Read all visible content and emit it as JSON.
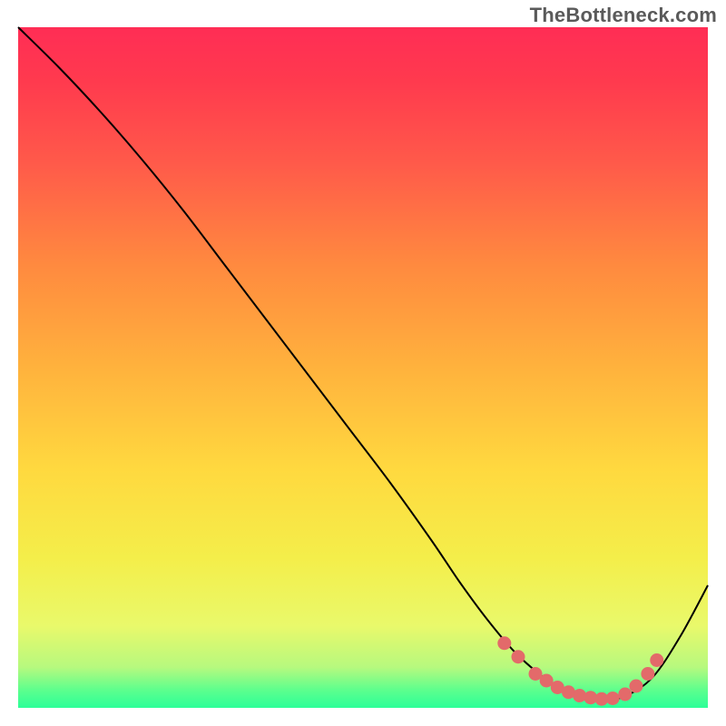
{
  "watermark": "TheBottleneck.com",
  "plot": {
    "margin_left": 20,
    "margin_right": 20,
    "margin_top": 30,
    "margin_bottom": 20,
    "gradient_stops": [
      {
        "offset": 0.0,
        "color": "#ff2d55"
      },
      {
        "offset": 0.08,
        "color": "#ff3a4e"
      },
      {
        "offset": 0.2,
        "color": "#ff5a4a"
      },
      {
        "offset": 0.35,
        "color": "#ff8a3f"
      },
      {
        "offset": 0.5,
        "color": "#ffb23d"
      },
      {
        "offset": 0.65,
        "color": "#ffd93f"
      },
      {
        "offset": 0.78,
        "color": "#f4ee4a"
      },
      {
        "offset": 0.88,
        "color": "#e9f96b"
      },
      {
        "offset": 0.94,
        "color": "#b7f97e"
      },
      {
        "offset": 0.975,
        "color": "#5aff8e"
      },
      {
        "offset": 1.0,
        "color": "#2cff98"
      }
    ]
  },
  "chart_data": {
    "type": "line",
    "title": "",
    "xlabel": "",
    "ylabel": "",
    "xlim": [
      0,
      100
    ],
    "ylim": [
      0,
      100
    ],
    "series": [
      {
        "name": "bottleneck-curve",
        "x": [
          0,
          6,
          12,
          18,
          24,
          30,
          36,
          42,
          48,
          54,
          60,
          64,
          68,
          72,
          76,
          79,
          82,
          85,
          88,
          92,
          96,
          100
        ],
        "y": [
          100,
          94,
          87.5,
          80.5,
          73,
          65,
          57,
          49,
          41,
          33,
          24.5,
          18.5,
          13,
          8.2,
          4.6,
          2.5,
          1.4,
          1.2,
          1.7,
          4.5,
          10.5,
          18
        ]
      }
    ],
    "optimal_range": {
      "color": "#e36a6a",
      "dot_radius_px": 7.5,
      "points": [
        {
          "x": 70.5,
          "y": 9.5
        },
        {
          "x": 72.5,
          "y": 7.5
        },
        {
          "x": 75.0,
          "y": 5.0
        },
        {
          "x": 76.6,
          "y": 4.0
        },
        {
          "x": 78.2,
          "y": 3.0
        },
        {
          "x": 79.8,
          "y": 2.3
        },
        {
          "x": 81.4,
          "y": 1.8
        },
        {
          "x": 83.0,
          "y": 1.5
        },
        {
          "x": 84.6,
          "y": 1.3
        },
        {
          "x": 86.2,
          "y": 1.4
        },
        {
          "x": 88.0,
          "y": 2.0
        },
        {
          "x": 89.6,
          "y": 3.2
        },
        {
          "x": 91.3,
          "y": 5.0
        },
        {
          "x": 92.6,
          "y": 7.0
        }
      ]
    }
  }
}
